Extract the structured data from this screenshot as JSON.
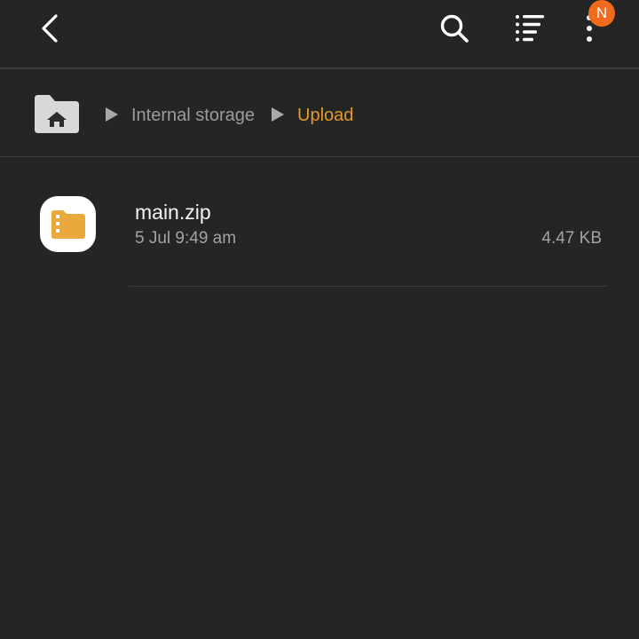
{
  "toolbar": {
    "badge_letter": "N"
  },
  "breadcrumb": {
    "items": [
      {
        "label": "Internal storage"
      },
      {
        "label": "Upload"
      }
    ]
  },
  "files": [
    {
      "name": "main.zip",
      "date": "5 Jul 9:49 am",
      "size": "4.47 KB",
      "icon": "zip-folder-icon"
    }
  ],
  "colors": {
    "background": "#252525",
    "accent": "#e39a28",
    "badge": "#f26a1b",
    "primary_text": "#f2f2f2",
    "secondary_text": "#a3a3a3"
  }
}
